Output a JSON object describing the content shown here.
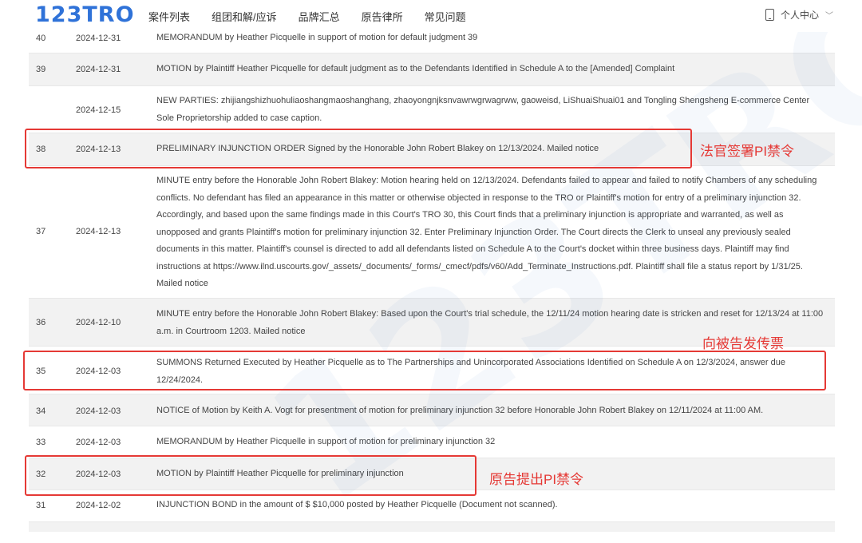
{
  "header": {
    "logo": "123TRO",
    "nav": [
      "案件列表",
      "组团和解/应诉",
      "品牌汇总",
      "原告律所",
      "常见问题"
    ],
    "user_label": "个人中心"
  },
  "rows": [
    {
      "num": "40",
      "date": "2024-12-31",
      "desc": "MEMORANDUM by Heather Picquelle in support of motion for default judgment 39"
    },
    {
      "num": "39",
      "date": "2024-12-31",
      "desc": "MOTION by Plaintiff Heather Picquelle for default judgment as to the Defendants Identified in Schedule A to the [Amended] Complaint"
    },
    {
      "num": "",
      "date": "2024-12-15",
      "desc": "NEW PARTIES: zhijiangshizhuohuliaoshangmaoshanghang, zhaoyongnjksnvawrwgrwagrww, gaoweisd, LiShuaiShuai01 and Tongling Shengsheng E-commerce Center Sole Proprietorship added to case caption."
    },
    {
      "num": "38",
      "date": "2024-12-13",
      "desc": "PRELIMINARY INJUNCTION ORDER Signed by the Honorable John Robert Blakey on 12/13/2024. Mailed notice"
    },
    {
      "num": "37",
      "date": "2024-12-13",
      "desc": "MINUTE entry before the Honorable John Robert Blakey: Motion hearing held on 12/13/2024. Defendants failed to appear and failed to notify Chambers of any scheduling conflicts. No defendant has filed an appearance in this matter or otherwise objected in response to the TRO or Plaintiff's motion for entry of a preliminary injunction 32. Accordingly, and based upon the same findings made in this Court's TRO 30, this Court finds that a preliminary injunction is appropriate and warranted, as well as unopposed and grants Plaintiff's motion for preliminary injunction 32. Enter Preliminary Injunction Order. The Court directs the Clerk to unseal any previously sealed documents in this matter. Plaintiff's counsel is directed to add all defendants listed on Schedule A to the Court's docket within three business days. Plaintiff may find instructions at https://www.ilnd.uscourts.gov/_assets/_documents/_forms/_cmecf/pdfs/v60/Add_Terminate_Instructions.pdf. Plaintiff shall file a status report by 1/31/25. Mailed notice"
    },
    {
      "num": "36",
      "date": "2024-12-10",
      "desc": "MINUTE entry before the Honorable John Robert Blakey: Based upon the Court's trial schedule, the 12/11/24 motion hearing date is stricken and reset for 12/13/24 at 11:00 a.m. in Courtroom 1203. Mailed notice"
    },
    {
      "num": "35",
      "date": "2024-12-03",
      "desc": "SUMMONS Returned Executed by Heather Picquelle as to The Partnerships and Unincorporated Associations Identified on Schedule A on 12/3/2024, answer due 12/24/2024."
    },
    {
      "num": "34",
      "date": "2024-12-03",
      "desc": "NOTICE of Motion by Keith A. Vogt for presentment of motion for preliminary injunction 32 before Honorable John Robert Blakey on 12/11/2024 at 11:00 AM."
    },
    {
      "num": "33",
      "date": "2024-12-03",
      "desc": "MEMORANDUM by Heather Picquelle in support of motion for preliminary injunction 32"
    },
    {
      "num": "32",
      "date": "2024-12-03",
      "desc": "MOTION by Plaintiff Heather Picquelle for preliminary injunction"
    },
    {
      "num": "31",
      "date": "2024-12-02",
      "desc": "INJUNCTION BOND in the amount of $ $10,000 posted by Heather Picquelle (Document not scanned)."
    }
  ],
  "annotations": [
    {
      "text": "法官签署PI禁令",
      "color": "#e53935"
    },
    {
      "text": "向被告发传票",
      "color": "#e53935"
    },
    {
      "text": "原告提出PI禁令",
      "color": "#e53935"
    }
  ],
  "watermark": "123TRO"
}
